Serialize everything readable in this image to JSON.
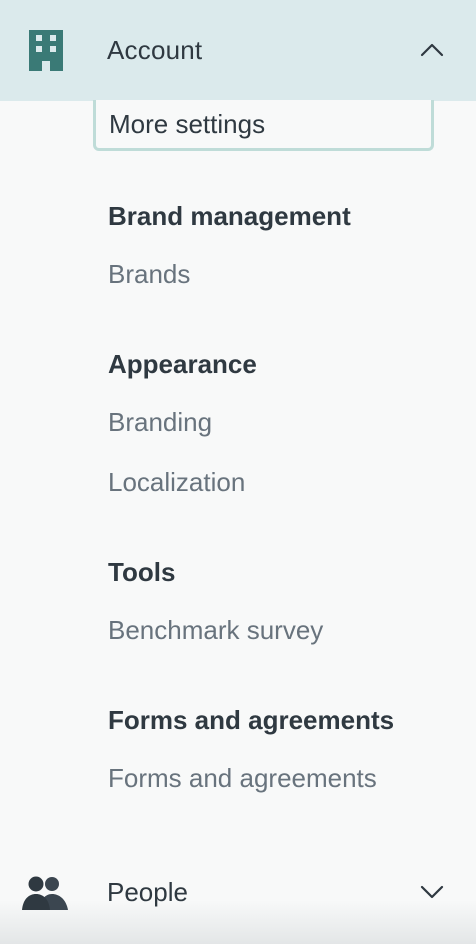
{
  "header": {
    "label": "Account",
    "icon": "building-icon",
    "expanded": true,
    "accent_color": "#dbeaec"
  },
  "account_menu": {
    "more_settings": "More settings",
    "sections": [
      {
        "title": "Brand management",
        "items": [
          "Brands"
        ]
      },
      {
        "title": "Appearance",
        "items": [
          "Branding",
          "Localization"
        ]
      },
      {
        "title": "Tools",
        "items": [
          "Benchmark survey"
        ]
      },
      {
        "title": "Forms and agreements",
        "items": [
          "Forms and agreements"
        ]
      }
    ]
  },
  "people": {
    "label": "People",
    "icon": "people-icon",
    "expanded": false
  }
}
